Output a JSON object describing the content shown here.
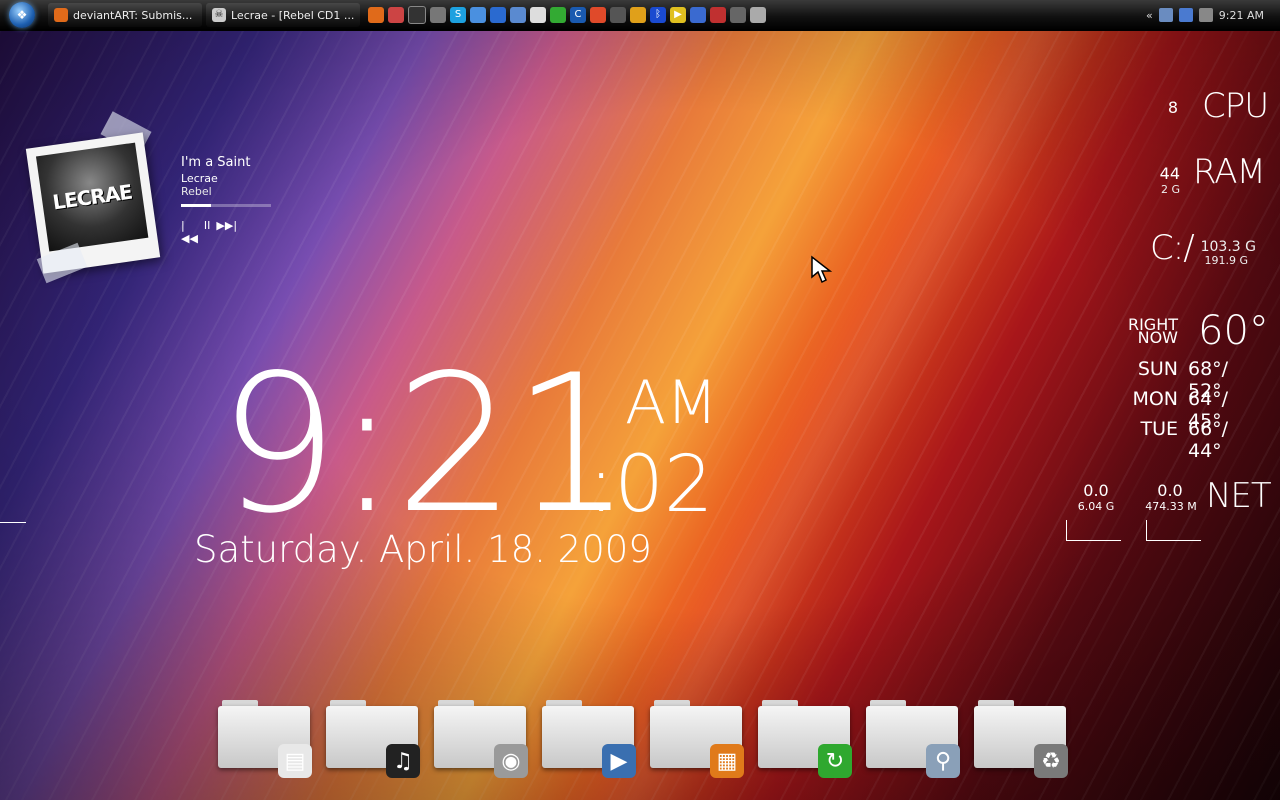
{
  "taskbar": {
    "tasks": [
      {
        "label": "deviantART: Submis..."
      },
      {
        "label": "Lecrae - [Rebel CD1 ..."
      }
    ],
    "quick_launch": [
      "firefox-icon",
      "box-icon",
      "camera-icon",
      "raccoon-icon",
      "skype-icon",
      "picasa-icon",
      "globe-icon",
      "window-icon",
      "calendar-icon",
      "ccleaner-icon",
      "chrome-icon",
      "grid-icon",
      "device-icon",
      "winamp-icon",
      "bluetooth-icon",
      "media-icon",
      "pen-icon",
      "shield-icon",
      "monitor-icon",
      "mask-icon"
    ],
    "tray": {
      "expand": "«",
      "time": "9:21 AM"
    }
  },
  "now_playing": {
    "album_art_text": "LECRAE",
    "title": "I'm a Saint",
    "artist": "Lecrae",
    "album": "Rebel",
    "progress": 0.33,
    "controls": {
      "prev": "|◀◀",
      "pause": "II",
      "next": "▶▶|"
    }
  },
  "clock": {
    "time": "9:21",
    "ampm": "AM",
    "seconds": ":02",
    "date": "Saturday. April. 18. 2009"
  },
  "stats": {
    "cpu": {
      "label": "CPU",
      "value": "8"
    },
    "ram": {
      "label": "RAM",
      "value": "44",
      "sub": "2 G"
    },
    "disk": {
      "label": "C:/",
      "free": "103.3 G",
      "total": "191.9 G"
    }
  },
  "weather": {
    "now_label_1": "RIGHT",
    "now_label_2": "NOW",
    "now_temp": "60°",
    "forecast": [
      {
        "day": "SUN",
        "temps": "68°/ 52°"
      },
      {
        "day": "MON",
        "temps": "64°/ 45°"
      },
      {
        "day": "TUE",
        "temps": "66°/ 44°"
      }
    ]
  },
  "net": {
    "label": "NET",
    "down_rate": "0.0",
    "down_total": "6.04 G",
    "up_rate": "0.0",
    "up_total": "474.33 M"
  },
  "dock": {
    "folders": [
      {
        "name": "documents-folder",
        "badge_icon": "document-icon",
        "badge": "▤",
        "badge_color": "#e8e8e8"
      },
      {
        "name": "music-folder",
        "badge_icon": "zune-icon",
        "badge": "♫",
        "badge_color": "#222222"
      },
      {
        "name": "pictures-folder",
        "badge_icon": "camera-icon",
        "badge": "◉",
        "badge_color": "#9a9a9a"
      },
      {
        "name": "videos-folder",
        "badge_icon": "film-icon",
        "badge": "▶",
        "badge_color": "#3a6fb0"
      },
      {
        "name": "office-folder",
        "badge_icon": "office-icon",
        "badge": "▦",
        "badge_color": "#e07a1a"
      },
      {
        "name": "downloads-folder",
        "badge_icon": "refresh-icon",
        "badge": "↻",
        "badge_color": "#2fa82f"
      },
      {
        "name": "search-folder",
        "badge_icon": "magnifier-icon",
        "badge": "⚲",
        "badge_color": "#8aa0b8"
      },
      {
        "name": "recycle-folder",
        "badge_icon": "trash-icon",
        "badge": "♻",
        "badge_color": "#7a7a7a"
      }
    ]
  }
}
